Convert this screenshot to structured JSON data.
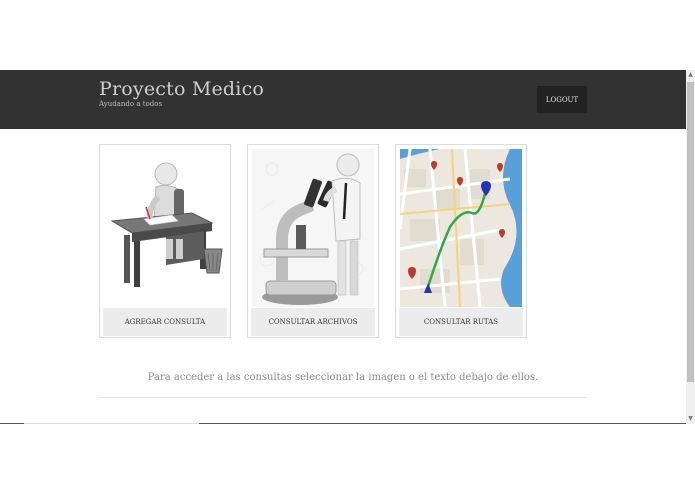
{
  "header": {
    "title": "Proyecto Medico",
    "subtitle": "Ayudando a todos",
    "logout_label": "LOGOUT"
  },
  "cards": [
    {
      "label": "AGREGAR CONSULTA",
      "icon": "person-at-desk-illustration"
    },
    {
      "label": "CONSULTAR ARCHIVOS",
      "icon": "person-with-microscope-illustration"
    },
    {
      "label": "CONSULTAR RUTAS",
      "icon": "city-map-route-illustration"
    }
  ],
  "info_text": "Para acceder a las consultas seleccionar la imagen o el texto debajo de ellos.",
  "colors": {
    "header_bg": "#333232",
    "button_bg": "#222222",
    "card_label_bg": "#ececec"
  }
}
